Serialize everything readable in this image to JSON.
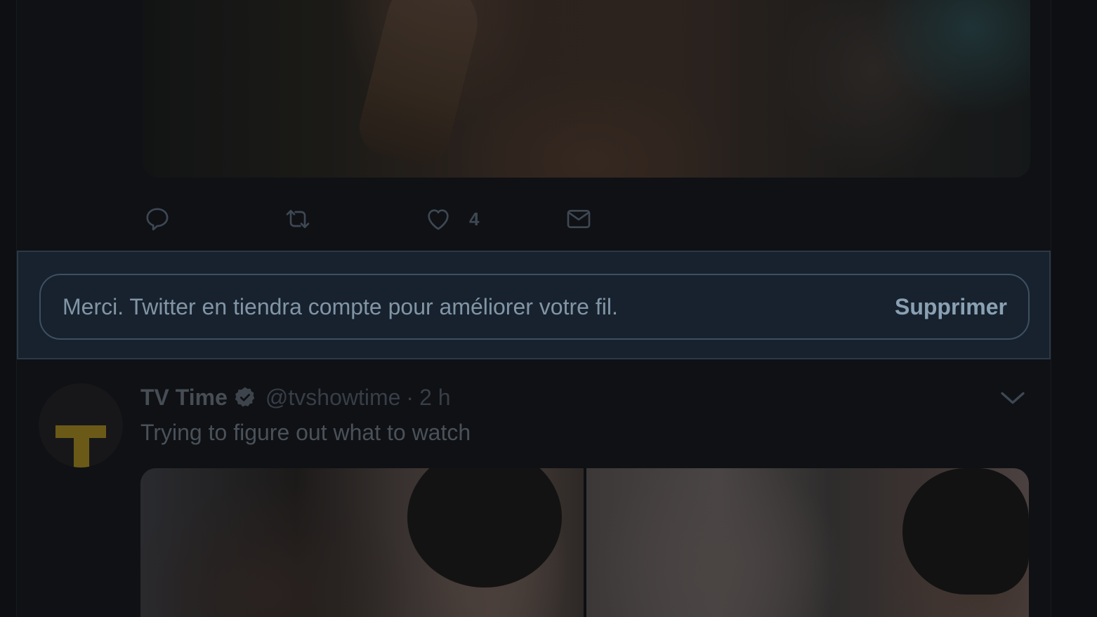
{
  "top_tweet": {
    "actions": {
      "reply_icon": "reply-bubble-icon",
      "retweet_icon": "retweet-icon",
      "like_icon": "heart-icon",
      "like_count": "4",
      "dm_icon": "envelope-icon"
    }
  },
  "feedback": {
    "message": "Merci. Twitter en tiendra compte pour améliorer votre fil.",
    "undo_label": "Supprimer"
  },
  "tweet2": {
    "display_name": "TV Time",
    "verified_icon": "verified-badge-icon",
    "handle": "@tvshowtime",
    "separator": "·",
    "time": "2 h",
    "text": "Trying to figure out what to watch",
    "menu_icon": "chevron-down-icon"
  },
  "colors": {
    "background": "#0f1115",
    "feedback_bg": "#17222e",
    "feedback_border": "#3e4f60",
    "muted_text": "#8295a5",
    "avatar_accent": "#6b5a17"
  }
}
